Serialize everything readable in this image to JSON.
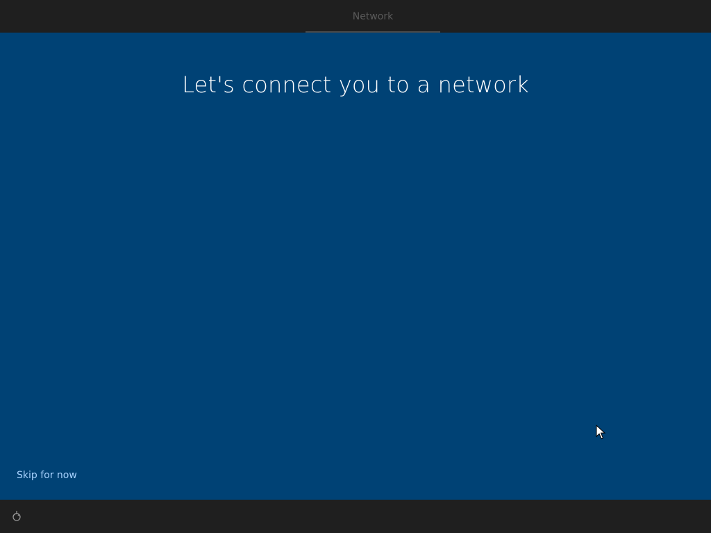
{
  "header": {
    "step_label": "Network"
  },
  "main": {
    "title": "Let's connect you to a network",
    "skip_label": "Skip for now"
  },
  "footer": {
    "accessibility_icon": "ease-of-access-icon"
  },
  "colors": {
    "background": "#004275",
    "bar": "#1f1f1f",
    "link": "#a8d3ff"
  }
}
